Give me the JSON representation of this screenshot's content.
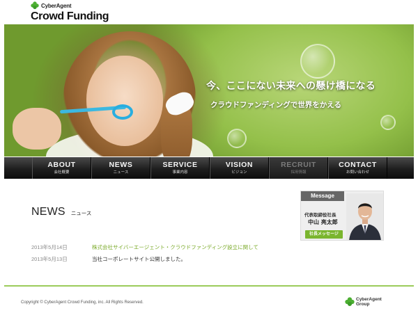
{
  "header": {
    "brand_small": "CyberAgent",
    "brand_big": "Crowd Funding"
  },
  "hero": {
    "tagline_main": "今、ここにない未来への懸け橋になる",
    "tagline_sub": "クラウドファンディングで世界をかえる"
  },
  "nav": {
    "items": [
      {
        "label": "ABOUT",
        "sub": "会社概要",
        "active": false
      },
      {
        "label": "NEWS",
        "sub": "ニュース",
        "active": false
      },
      {
        "label": "SERVICE",
        "sub": "事業内容",
        "active": false
      },
      {
        "label": "VISION",
        "sub": "ビジョン",
        "active": false
      },
      {
        "label": "RECRUIT",
        "sub": "採用情報",
        "active": true
      },
      {
        "label": "CONTACT",
        "sub": "お問い合わせ",
        "active": false
      }
    ]
  },
  "news": {
    "heading": "NEWS",
    "heading_sub": "ニュース",
    "items": [
      {
        "date": "2013年5月14日",
        "title": "株式会社サイバーエージェント・クラウドファンディング設立に関して",
        "link": true
      },
      {
        "date": "2013年5月13日",
        "title": "当社コーポレートサイト公開しました。",
        "link": false
      }
    ]
  },
  "message_card": {
    "tag": "Message",
    "role": "代表取締役社長",
    "name": "中山 亮太郎",
    "button": "社長メッセージ"
  },
  "footer": {
    "copyright": "Copyright © CyberAgent Crowd Funding, inc. All Rights Reserved.",
    "group_logo_line1": "CyberAgent",
    "group_logo_line2": "Group"
  },
  "colors": {
    "accent_green": "#7ab52e",
    "nav_bg": "#1e1e1e",
    "footer_line": "#9bcb5a"
  }
}
